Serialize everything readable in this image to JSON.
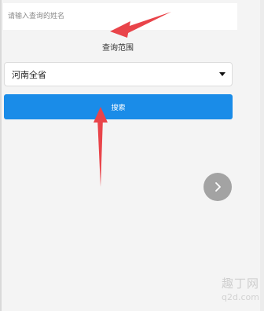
{
  "search": {
    "placeholder": "请输入查询的姓名",
    "value": ""
  },
  "scope": {
    "title": "查询范围",
    "selected": "河南全省"
  },
  "search_button": {
    "label": "搜索"
  },
  "next_button": {
    "icon": "chevron-right-icon"
  },
  "watermark": {
    "text_cn": "趣丁网",
    "url": "q2d.com"
  },
  "colors": {
    "accent": "#1a8ce8",
    "arrow": "#e9444a"
  }
}
